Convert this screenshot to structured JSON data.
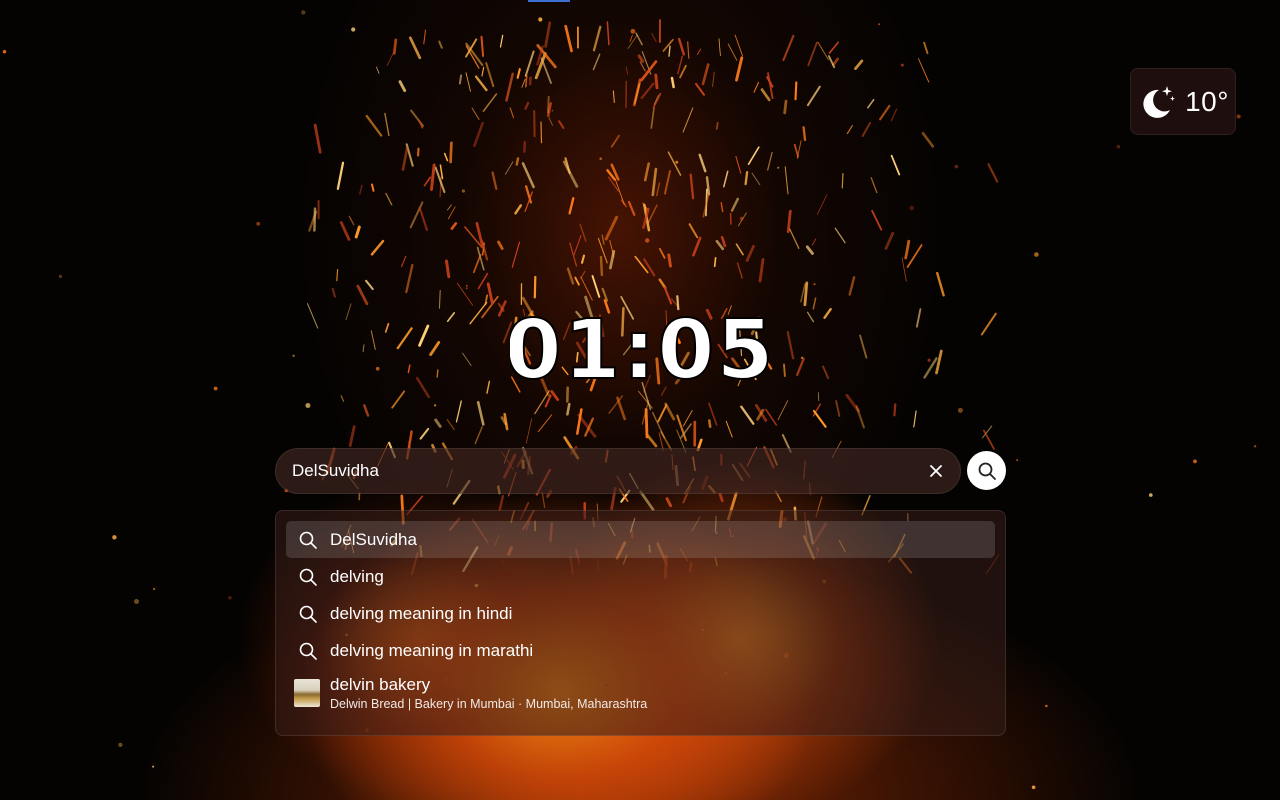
{
  "weather": {
    "icon": "moon-stars-icon",
    "temperature": "10°"
  },
  "clock": {
    "time": "01:05"
  },
  "search": {
    "value": "DelSuvidha",
    "clear_icon": "close-icon",
    "submit_icon": "search-icon"
  },
  "suggestions": [
    {
      "icon": "search-icon",
      "text": "DelSuvidha",
      "active": true
    },
    {
      "icon": "search-icon",
      "text": "delving"
    },
    {
      "icon": "search-icon",
      "text": "delving meaning in hindi"
    },
    {
      "icon": "search-icon",
      "text": "delving meaning in marathi"
    }
  ],
  "rich_suggestion": {
    "icon": "bakery-thumbnail",
    "title": "delvin bakery",
    "subtitle": "Delwin Bread | Bakery in Mumbai · Mumbai, Maharashtra"
  },
  "colors": {
    "accent_line": "#3b6fd0",
    "text": "#ffffff"
  }
}
